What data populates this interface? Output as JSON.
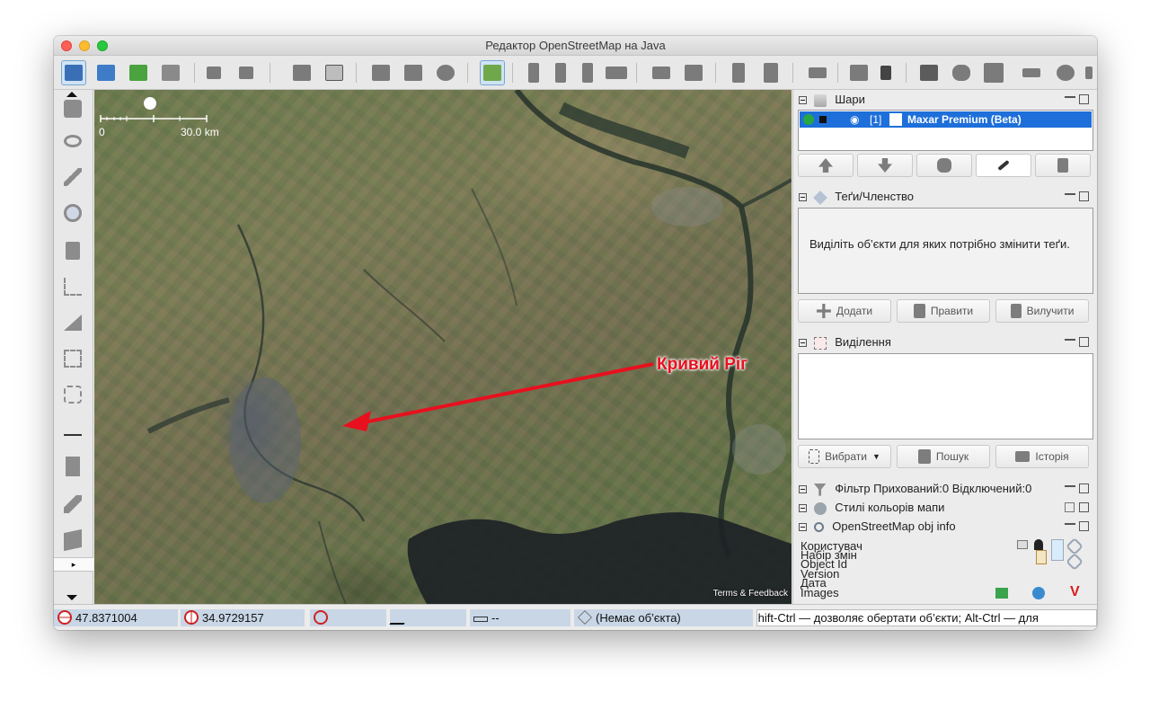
{
  "window": {
    "title": "Редактор OpenStreetMap на Java"
  },
  "colors": {
    "accent": "#1e6fd9",
    "annotation": "#e8101e",
    "statusfield": "#c8d6e6"
  },
  "toolbar": {
    "icons": [
      "open-icon",
      "upload-icon",
      "download-icon",
      "save-icon",
      "undo-icon",
      "redo-icon",
      "preferences-icon",
      "presets-icon",
      "split-way-icon",
      "combine-way-icon",
      "refresh-icon",
      "zoom-fit-icon",
      "highway-icon",
      "track-icon",
      "signals-icon",
      "building-icon",
      "car-icon",
      "bus-icon",
      "shop-icon",
      "restaurant-icon",
      "castle-icon",
      "industrial-icon",
      "select-icon",
      "nodes-icon",
      "area-icon",
      "rail-icon",
      "ruler-icon",
      "osm-icon"
    ]
  },
  "left_tools": [
    "select-tool-icon",
    "lasso-icon",
    "draw-icon",
    "zoom-icon",
    "delete-icon",
    "split-icon",
    "triangle-icon",
    "combine-icon",
    "align-icon",
    "move-node-icon",
    "door-icon",
    "pencil-icon",
    "stack-icon"
  ],
  "map": {
    "scale_zero": "0",
    "scale_label": "30.0 km",
    "terms": "Terms & Feedback",
    "annotation_label": "Кривий Ріг"
  },
  "panels": {
    "layers": {
      "title": "Шари",
      "row_index": "[1]",
      "row_name": "Maxar Premium (Beta)",
      "buttons": [
        "move-up-icon",
        "move-down-icon",
        "merge-icon",
        "visibility-icon",
        "delete-layer-icon"
      ]
    },
    "tags": {
      "title": "Теґи/Членство",
      "hint": "Виділіть об’єкти для яких потрібно змінити теґи.",
      "add": "Додати",
      "edit": "Правити",
      "delete": "Вилучити"
    },
    "selection": {
      "title": "Виділення",
      "select": "Вибрати",
      "search": "Пошук",
      "history": "Історія"
    },
    "filter": {
      "title": "Фільтр Прихований:0 Відключений:0"
    },
    "styles": {
      "title": "Стилі кольорів мапи"
    },
    "objinfo": {
      "title": "OpenStreetMap obj info",
      "rows": [
        "Користувач",
        "Набір змін",
        "Object Id",
        "Version",
        "Дата",
        "Images"
      ]
    }
  },
  "status": {
    "lat": "47.8371004",
    "lon": "34.9729157",
    "heading": "",
    "angle": "",
    "distance": "--",
    "object": "(Немає об’єкта)",
    "help": "Shift-Ctrl — дозволяє обертати об’єкти; Alt-Ctrl — для"
  }
}
